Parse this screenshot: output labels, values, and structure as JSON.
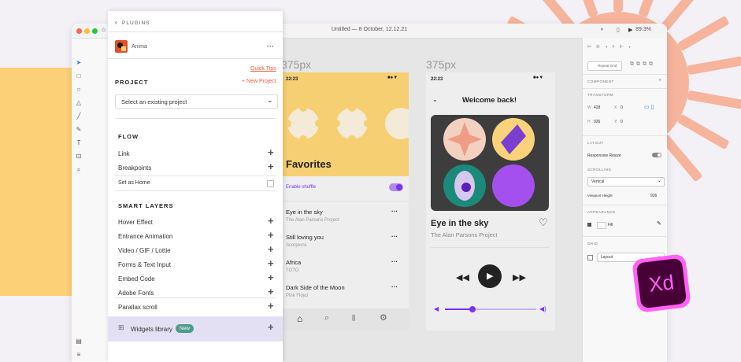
{
  "window": {
    "title": "Untitled — 8 October, 12.12.21",
    "zoom": "89.3%"
  },
  "plugin": {
    "back_label": "PLUGINS",
    "name": "Anima",
    "more": "···",
    "quick_tips": "Quick Tips",
    "project_label": "PROJECT",
    "new_project": "+ New Project",
    "select_placeholder": "Select an existing project",
    "flow_label": "FLOW",
    "flow_items": [
      "Link",
      "Breakpoints"
    ],
    "set_as_home": "Set as Home",
    "smart_label": "SMART LAYERS",
    "smart_items": [
      "Hover Effect",
      "Entrance Animation",
      "Video / GIF / Lottie",
      "Forms & Text Input",
      "Embed Code",
      "Adobe Fonts",
      "Parallax scroll"
    ],
    "widgets_label": "Widgets library",
    "new_badge": "New"
  },
  "artboard1": {
    "label": "375px",
    "time": "22:23",
    "title": "Favorites",
    "shuffle": "Enable shuffle",
    "songs": [
      {
        "title": "Eye in the sky",
        "artist": "The Alan Parsons Project"
      },
      {
        "title": "Still loving you",
        "artist": "Scorpions"
      },
      {
        "title": "Africa",
        "artist": "TOTO"
      },
      {
        "title": "Dark Side of the Moon",
        "artist": "Pink Floyd"
      }
    ]
  },
  "artboard2": {
    "label": "375px",
    "time": "22:23",
    "header": "Welcome back!",
    "song": "Eye in the sky",
    "artist": "The Alan Parsons Project",
    "progress": 0.3
  },
  "inspector": {
    "repeat_grid": "Repeat Grid",
    "component": "COMPONENT",
    "transform": "TRANSFORM",
    "w_label": "W",
    "w_value": "428",
    "h_label": "H",
    "h_value": "926",
    "x_label": "X",
    "x_value": "0",
    "y_label": "Y",
    "y_value": "0",
    "layout": "LAYOUT",
    "responsive": "Responsive Resize",
    "scrolling": "SCROLLING",
    "scroll_value": "Vertical",
    "viewport_label": "Viewport Height",
    "viewport_value": "926",
    "appearance": "APPEARANCE",
    "fill": "Fill",
    "grid": "GRID",
    "grid_value": "Layout"
  },
  "colors": {
    "accent": "#7b2ff7",
    "link": "#ff5a3c",
    "yellow": "#f7cf73",
    "xd_pink": "#ff61f6",
    "xd_dark": "#470137"
  },
  "icons": [
    "search-icon",
    "home-icon",
    "settings-icon",
    "play-icon",
    "rewind-icon",
    "forward-icon",
    "heart-icon",
    "more-icon",
    "xd-logo"
  ]
}
